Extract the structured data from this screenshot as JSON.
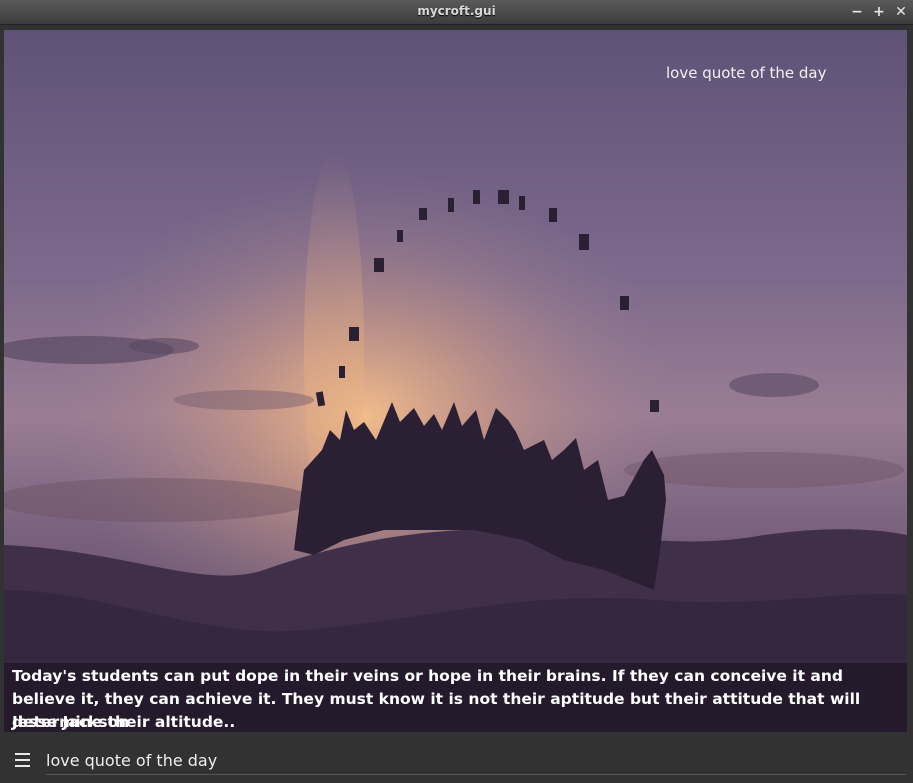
{
  "window": {
    "title": "mycroft.gui",
    "minimize_label": "−",
    "maximize_label": "+",
    "close_label": "✕"
  },
  "skill": {
    "overlay_title": "love quote of the day",
    "quote": "Today's students can put dope in their veins or hope in their brains. If they can conceive it and believe it, they can achieve it. They must know it is not their aptitude but their attitude that will determine their altitude..",
    "author": "Jesse Jackson"
  },
  "bottombar": {
    "menu_icon": "hamburger-menu-icon",
    "utterance": "love quote of the day"
  },
  "colors": {
    "sky_top": "#6b5a7f",
    "sky_glow": "#e8a77a",
    "hill": "#3a2a45",
    "silhouette": "#2b1f33"
  }
}
